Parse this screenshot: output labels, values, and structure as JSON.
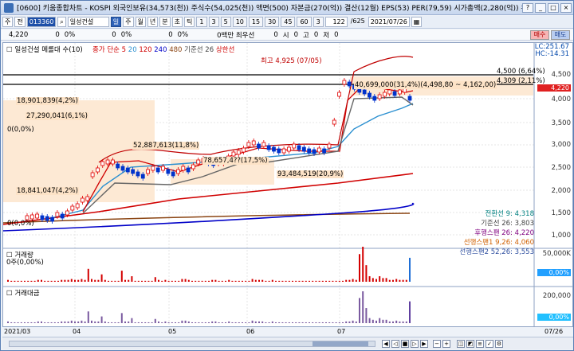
{
  "titlebar": {
    "text": "[0600] 키움종합차트 - KOSPI 외국인보유(34,573(천)) 주식수(54,025(천)) 액면(500) 자본금(270(억)) 결산(12월) EPS(53) PER(79,59) 시가총액(2,280(억)) 유",
    "buttons": [
      "?",
      "_",
      "□",
      "×"
    ]
  },
  "toolbar": {
    "type_select": "주",
    "period_select": "전",
    "code": "013360",
    "stock_name": "일성건설",
    "period_tabs": [
      "일",
      "주",
      "월",
      "년",
      "분",
      "초",
      "틱"
    ],
    "selected_period": "일",
    "interval_buttons": [
      "1",
      "3",
      "5",
      "10",
      "15",
      "30",
      "45",
      "60",
      "3"
    ],
    "count_value": "122",
    "count_total": "/625",
    "date_value": "2021/07/26"
  },
  "infobar": {
    "price": "4,220",
    "change": "0",
    "change_pct": "0%",
    "val1": "0",
    "val2": "0%",
    "val3": "0",
    "val4": "0%",
    "vol_label": "0백만 최우선",
    "s1": "0",
    "open_label": "시",
    "open": "0",
    "high_label": "고",
    "high": "0",
    "low_label": "저",
    "low": "0",
    "buy_label": "매수",
    "sell_label": "매도"
  },
  "price_panel": {
    "title": "일성건설 메롤대 수(10)",
    "ma_legend": [
      "종가 단순 5",
      "20",
      "120",
      "240",
      "480",
      "기준선 26",
      "상한선"
    ],
    "ma_colors": [
      "#d00000",
      "#2a8fd0",
      "#d00000",
      "#0000c8",
      "#8b4513",
      "#444444",
      "#d00000"
    ],
    "corner_top": "LC:251.67",
    "corner_bottom": "HC:-14.31",
    "max_label": "최고 4,925 (07/05)",
    "level_labels": [
      "4,500 (6,64%)",
      "4,309 (2,11%)"
    ],
    "price_box": "4,220",
    "annotations": [
      "18,901,839(4,2%)",
      "27,290,041(6,1%)",
      "0(0,0%)",
      "52,887,613(11,8%)",
      "78,657,4??(17,5%)",
      "93,484,519(20,9%)",
      "18,841,047(4,2%)",
      "0(0,0%)",
      "40,699,000(31,4%)(4,498,80 ~ 4,162,00)"
    ],
    "y_ticks": [
      "4,500",
      "4,000",
      "3,500",
      "3,000",
      "2,500",
      "2,000",
      "1,500",
      "1,000"
    ],
    "legend_right": [
      {
        "text": "전환선 9: 4,318",
        "color": "#008080"
      },
      {
        "text": "기준선 26: 3,803",
        "color": "#444444"
      },
      {
        "text": "후행스팬 26: 4,220",
        "color": "#800080"
      },
      {
        "text": "선행스팬1 9,26: 4,060",
        "color": "#d06000"
      },
      {
        "text": "선행스팬2 52,26: 3,553",
        "color": "#3050a0"
      }
    ]
  },
  "volume_panel": {
    "title": "거래량",
    "subtitle": "0주(0,00%)",
    "y_ticks": [
      "50,000K",
      "0,00%"
    ]
  },
  "amount_panel": {
    "title": "거래대금",
    "y_ticks": [
      "200,000",
      "0,00%"
    ]
  },
  "xaxis": [
    "2021/03",
    "04",
    "05",
    "06",
    "07",
    "07/26"
  ],
  "chart_data": {
    "type": "candlestick",
    "volume": [
      2,
      1,
      1,
      1,
      1,
      1,
      1,
      1,
      1,
      2,
      2,
      1,
      1,
      1,
      1,
      1,
      2,
      2,
      2,
      3,
      2,
      2,
      3,
      2,
      14,
      3,
      2,
      2,
      8,
      2,
      1,
      1,
      1,
      1,
      12,
      2,
      2,
      6,
      1,
      1,
      1,
      1,
      1,
      1,
      5,
      2,
      1,
      2,
      1,
      1,
      1,
      1,
      3,
      3,
      2,
      1,
      1,
      1,
      1,
      1,
      1,
      2,
      2,
      1,
      1,
      1,
      2,
      1,
      1,
      1,
      1,
      1,
      1,
      3,
      2,
      2,
      2,
      1,
      1,
      2,
      1,
      1,
      1,
      1,
      1,
      1,
      1,
      1,
      1,
      1,
      1,
      1,
      1,
      1,
      1,
      1,
      1,
      1,
      1,
      1,
      1,
      2,
      2,
      3,
      2,
      30,
      38,
      18,
      6,
      4,
      3,
      6,
      4,
      4,
      2,
      2,
      3,
      2,
      2,
      2,
      26
    ]
  }
}
